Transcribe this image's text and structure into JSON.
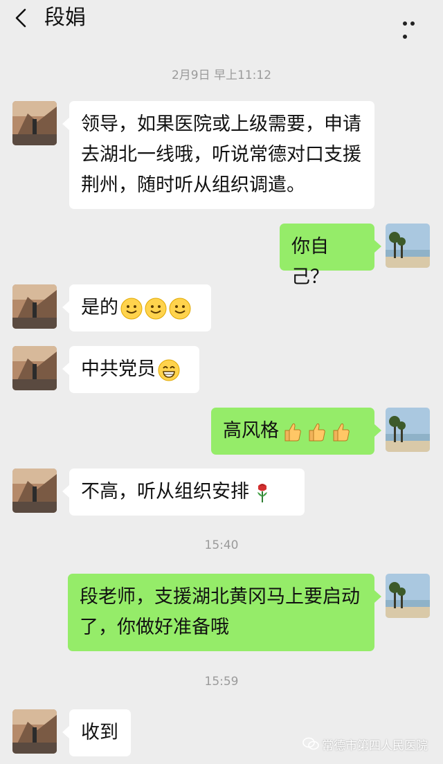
{
  "header": {
    "back_icon": "chevron-left-icon",
    "title": "段娟",
    "more_icon": "more-dots-icon"
  },
  "messages": [
    {
      "type": "time",
      "text": "2月9日 早上11:12"
    },
    {
      "type": "msg",
      "side": "left",
      "text": "领导，如果医院或上级需要，申请去湖北一线哦，听说常德对口支援 荆州，随时听从组织调遣。"
    },
    {
      "type": "msg",
      "side": "right",
      "text": "你自己？"
    },
    {
      "type": "msg",
      "side": "left",
      "text": "是的",
      "emoji": [
        "smile-emoji",
        "smile-emoji",
        "smile-emoji"
      ]
    },
    {
      "type": "msg",
      "side": "left",
      "text": "中共党员",
      "emoji": [
        "grin-emoji"
      ]
    },
    {
      "type": "msg",
      "side": "right",
      "text": "高风格",
      "emoji": [
        "thumbs-up-emoji",
        "thumbs-up-emoji",
        "thumbs-up-emoji"
      ]
    },
    {
      "type": "msg",
      "side": "left",
      "text": "不高，听从组织安排",
      "emoji": [
        "rose-emoji"
      ]
    },
    {
      "type": "time",
      "text": "15:40"
    },
    {
      "type": "msg",
      "side": "right",
      "text": "段老师，支援湖北黄冈马上要启动了，你做好准备哦"
    },
    {
      "type": "time",
      "text": "15:59"
    },
    {
      "type": "msg",
      "side": "left",
      "text": "收到"
    }
  ],
  "watermark": {
    "text": "常德市第四人民医院",
    "icon": "wechat-icon"
  },
  "colors": {
    "background": "#ededed",
    "sent_bubble": "#95ec69",
    "received_bubble": "#ffffff",
    "timestamp": "#9a9a9a"
  }
}
